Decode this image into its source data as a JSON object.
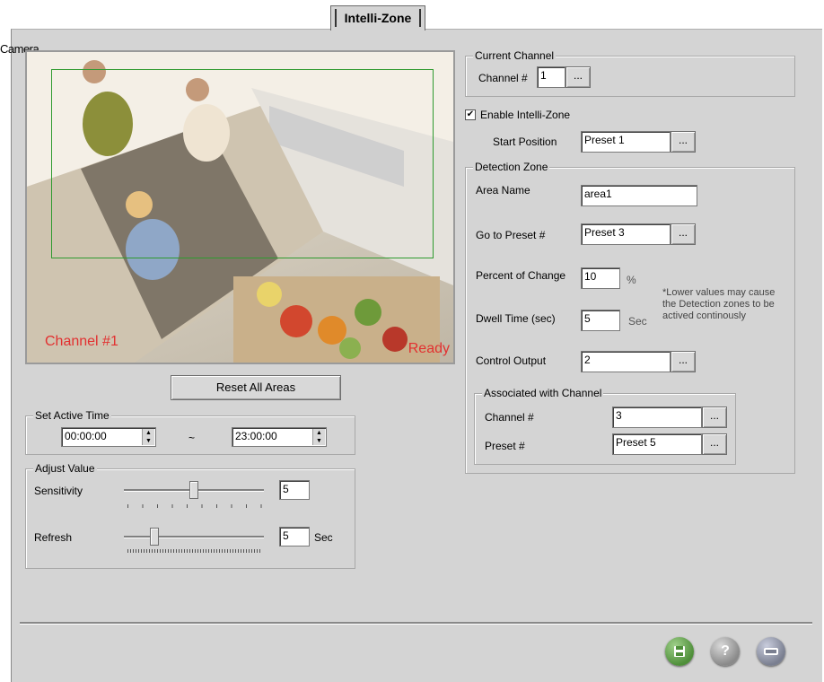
{
  "tab": {
    "label": "Intelli-Zone"
  },
  "camera": {
    "section_label": "Camera",
    "overlay_channel": "Channel #1",
    "overlay_status": "Ready"
  },
  "reset_button": "Reset All Areas",
  "active_time": {
    "legend": "Set Active Time",
    "start": "00:00:00",
    "separator": "~",
    "end": "23:00:00"
  },
  "adjust": {
    "legend": "Adjust Value",
    "sensitivity_label": "Sensitivity",
    "sensitivity_value": "5",
    "sensitivity_level": 0.5,
    "refresh_label": "Refresh",
    "refresh_value": "5",
    "refresh_unit": "Sec",
    "refresh_level": 0.2
  },
  "current_channel": {
    "legend": "Current Channel",
    "label": "Channel #",
    "value": "1",
    "browse": "..."
  },
  "enable": {
    "checked": true,
    "check_mark": "✔",
    "label": "Enable Intelli-Zone",
    "start_position_label": "Start Position",
    "start_position_value": "Preset 1"
  },
  "detection_zone": {
    "legend": "Detection Zone",
    "area_name_label": "Area Name",
    "area_name_value": "area1",
    "goto_preset_label": "Go to Preset #",
    "goto_preset_value": "Preset 3",
    "percent_label": "Percent of Change",
    "percent_value": "10",
    "percent_unit": "%",
    "note": "*Lower values may cause the Detection zones to be actived continously",
    "dwell_label": "Dwell Time (sec)",
    "dwell_value": "5",
    "dwell_unit": "Sec",
    "control_output_label": "Control Output",
    "control_output_value": "2",
    "associated": {
      "legend": "Associated with Channel",
      "channel_label": "Channel #",
      "channel_value": "3",
      "preset_label": "Preset #",
      "preset_value": "Preset 5"
    }
  },
  "colors": {
    "zone_outline": "#2f9a2f",
    "overlay_text": "#e23030",
    "save_button": "#4f8f3a",
    "help_button": "#8a8a8a",
    "close_button": "#7a7f90"
  },
  "footer": {
    "save_icon": "save-icon",
    "help_symbol": "?",
    "close_icon": "exit-icon"
  }
}
